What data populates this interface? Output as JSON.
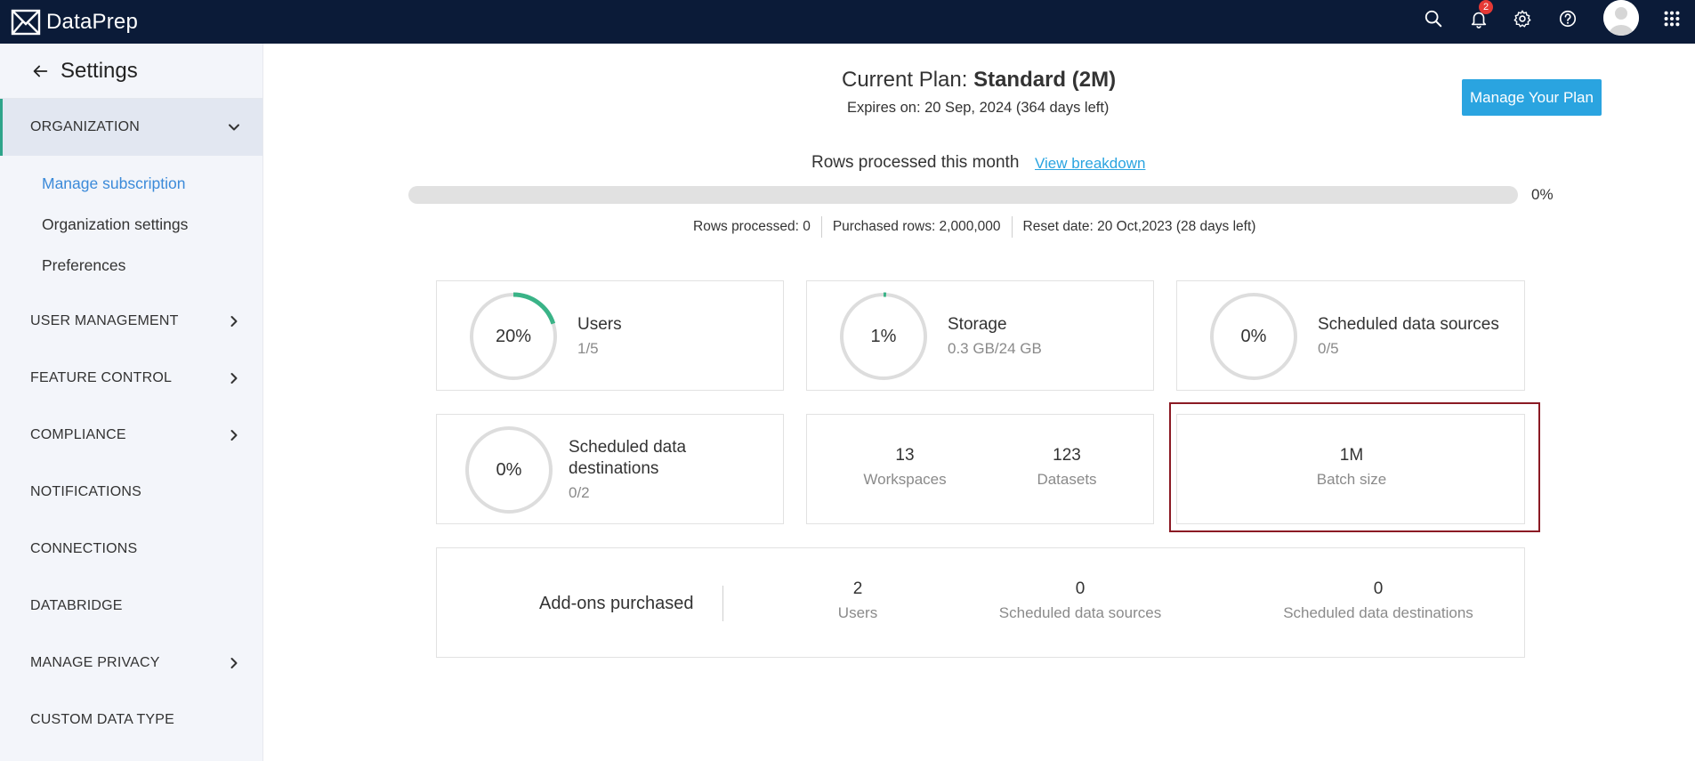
{
  "app": {
    "name": "DataPrep"
  },
  "topbar": {
    "notification_count": "2",
    "icons": [
      "search-icon",
      "bell-icon",
      "gear-icon",
      "help-icon",
      "avatar",
      "apps-grid-icon"
    ]
  },
  "sidebar": {
    "title": "Settings",
    "sections": [
      {
        "label": "ORGANIZATION",
        "expanded": true
      },
      {
        "label": "USER MANAGEMENT"
      },
      {
        "label": "FEATURE CONTROL"
      },
      {
        "label": "COMPLIANCE"
      },
      {
        "label": "NOTIFICATIONS"
      },
      {
        "label": "CONNECTIONS"
      },
      {
        "label": "DATABRIDGE"
      },
      {
        "label": "MANAGE PRIVACY"
      },
      {
        "label": "CUSTOM DATA TYPE"
      }
    ],
    "sub_items": [
      {
        "label": "Manage subscription",
        "active": true
      },
      {
        "label": "Organization settings"
      },
      {
        "label": "Preferences"
      }
    ]
  },
  "plan": {
    "prefix": "Current Plan: ",
    "name": "Standard (2M)",
    "expires": "Expires on: 20 Sep, 2024 (364 days left)",
    "manage_button": "Manage Your Plan"
  },
  "rows": {
    "label": "Rows processed this month",
    "link": "View breakdown",
    "progress_percent": 0,
    "percent_text": "0%",
    "processed": "Rows processed: 0",
    "purchased": "Purchased rows: 2,000,000",
    "reset": "Reset date: 20 Oct,2023 (28 days left)"
  },
  "cards": {
    "users": {
      "pct": "20%",
      "fraction": 0.2,
      "name": "Users",
      "value": "1/5"
    },
    "storage": {
      "pct": "1%",
      "fraction": 0.01,
      "name": "Storage",
      "value": "0.3 GB/24 GB"
    },
    "sched_sources": {
      "pct": "0%",
      "fraction": 0,
      "name": "Scheduled data sources",
      "value": "0/5"
    },
    "sched_dest": {
      "pct": "0%",
      "fraction": 0,
      "name_line1": "Scheduled data",
      "name_line2": "destinations",
      "value": "0/2"
    },
    "workspaces": {
      "num": "13",
      "label": "Workspaces"
    },
    "datasets": {
      "num": "123",
      "label": "Datasets"
    },
    "batch": {
      "num": "1M",
      "label": "Batch size"
    }
  },
  "addons": {
    "title": "Add-ons purchased",
    "items": [
      {
        "num": "2",
        "label": "Users"
      },
      {
        "num": "0",
        "label": "Scheduled data sources"
      },
      {
        "num": "0",
        "label": "Scheduled data destinations"
      }
    ]
  },
  "colors": {
    "topbar": "#0b1b38",
    "accent_blue": "#2aa4e0",
    "ring_green": "#3ab387",
    "ring_track": "#dddddd",
    "highlight": "#8b1a24"
  }
}
